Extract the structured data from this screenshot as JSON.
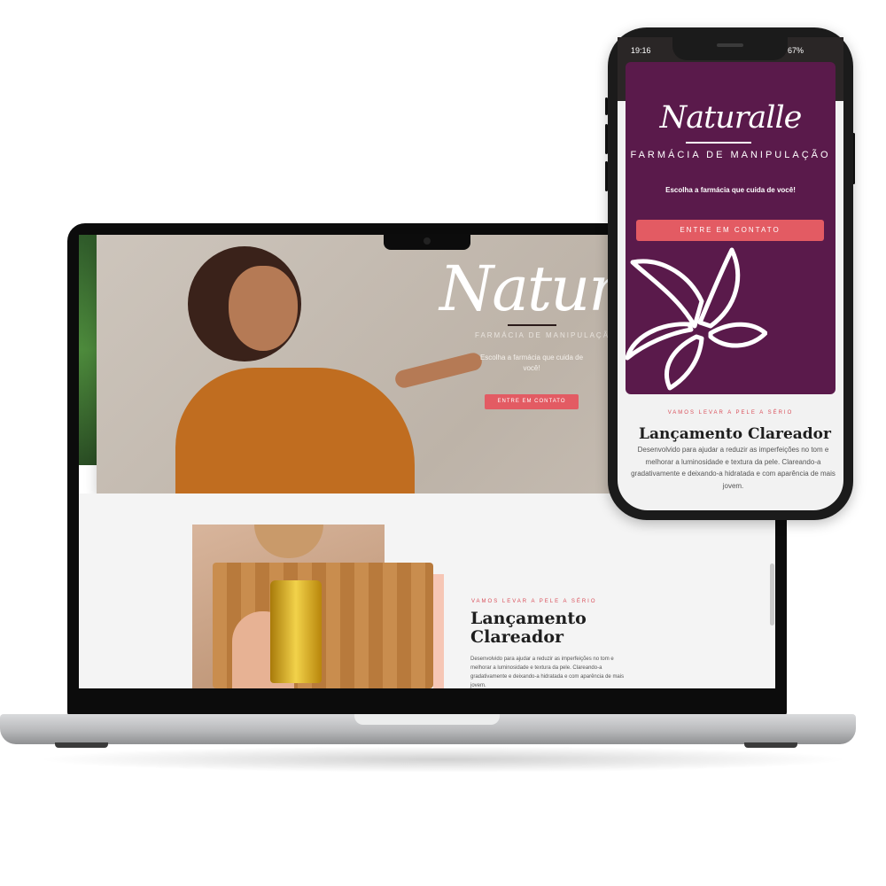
{
  "desktop": {
    "hero": {
      "logo": "Naturalle",
      "subtitle": "FARMÁCIA DE MANIPULAÇÃO",
      "tagline": "Escolha a farmácia que cuida de você!",
      "cta": "ENTRE EM CONTATO"
    },
    "section": {
      "kicker": "VAMOS LEVAR A PELE A SÉRIO",
      "title": "Lançamento Clareador",
      "body": "Desenvolvido para ajudar a reduzir as imperfeições no tom e melhorar a luminosidade e textura da pele. Clareando-a gradativamente e deixando-a hidratada e com aparência de mais jovem."
    }
  },
  "phone": {
    "status": {
      "time": "19:16",
      "battery": "67%"
    },
    "hero": {
      "logo": "Naturalle",
      "subtitle": "FARMÁCIA DE MANIPULAÇÃO",
      "tagline": "Escolha a farmácia que cuida de você!",
      "cta": "ENTRE EM CONTATO"
    },
    "section": {
      "kicker": "VAMOS LEVAR A PELE A SÉRIO",
      "title": "Lançamento Clareador",
      "body": "Desenvolvido para ajudar a reduzir as imperfeições no tom e melhorar a luminosidade e textura da pele. Clareando-a gradativamente e deixando-a hidratada e com aparência de mais jovem."
    }
  },
  "colors": {
    "brand_purple": "#5a1a4b",
    "cta_red": "#e35b63",
    "kicker_red": "#d94f5a"
  },
  "icons": [
    "flower-logo-icon"
  ]
}
